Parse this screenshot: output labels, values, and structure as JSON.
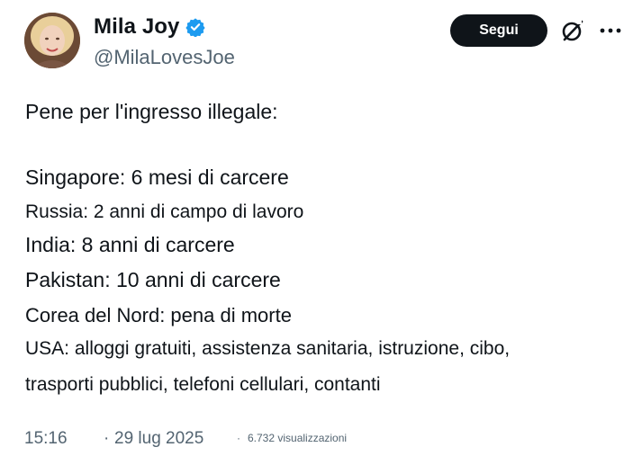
{
  "author": {
    "name": "Mila Joy",
    "handle": "@MilaLovesJoe",
    "verified_color": "#1d9bf0"
  },
  "actions": {
    "follow_label": "Segui",
    "grok_icon": "grok-icon",
    "more_icon": "more-icon"
  },
  "tweet": {
    "intro": "Pene per l'ingresso illegale:",
    "lines": [
      "Singapore: 6 mesi di carcere",
      "Russia: 2 anni di campo di lavoro",
      "India: 8 anni di carcere",
      "Pakistan: 10 anni di carcere",
      "Corea del Nord: pena di morte",
      "USA: alloggi gratuiti, assistenza sanitaria, istruzione, cibo,",
      "trasporti pubblici, telefoni cellulari, contanti"
    ]
  },
  "meta": {
    "time": "15:16",
    "separator": "·",
    "date": "29 lug 2025",
    "views": "6.732 visualizzazioni"
  },
  "colors": {
    "text": "#0f1419",
    "muted": "#536471",
    "button_bg": "#0f1419",
    "verified": "#1d9bf0"
  }
}
